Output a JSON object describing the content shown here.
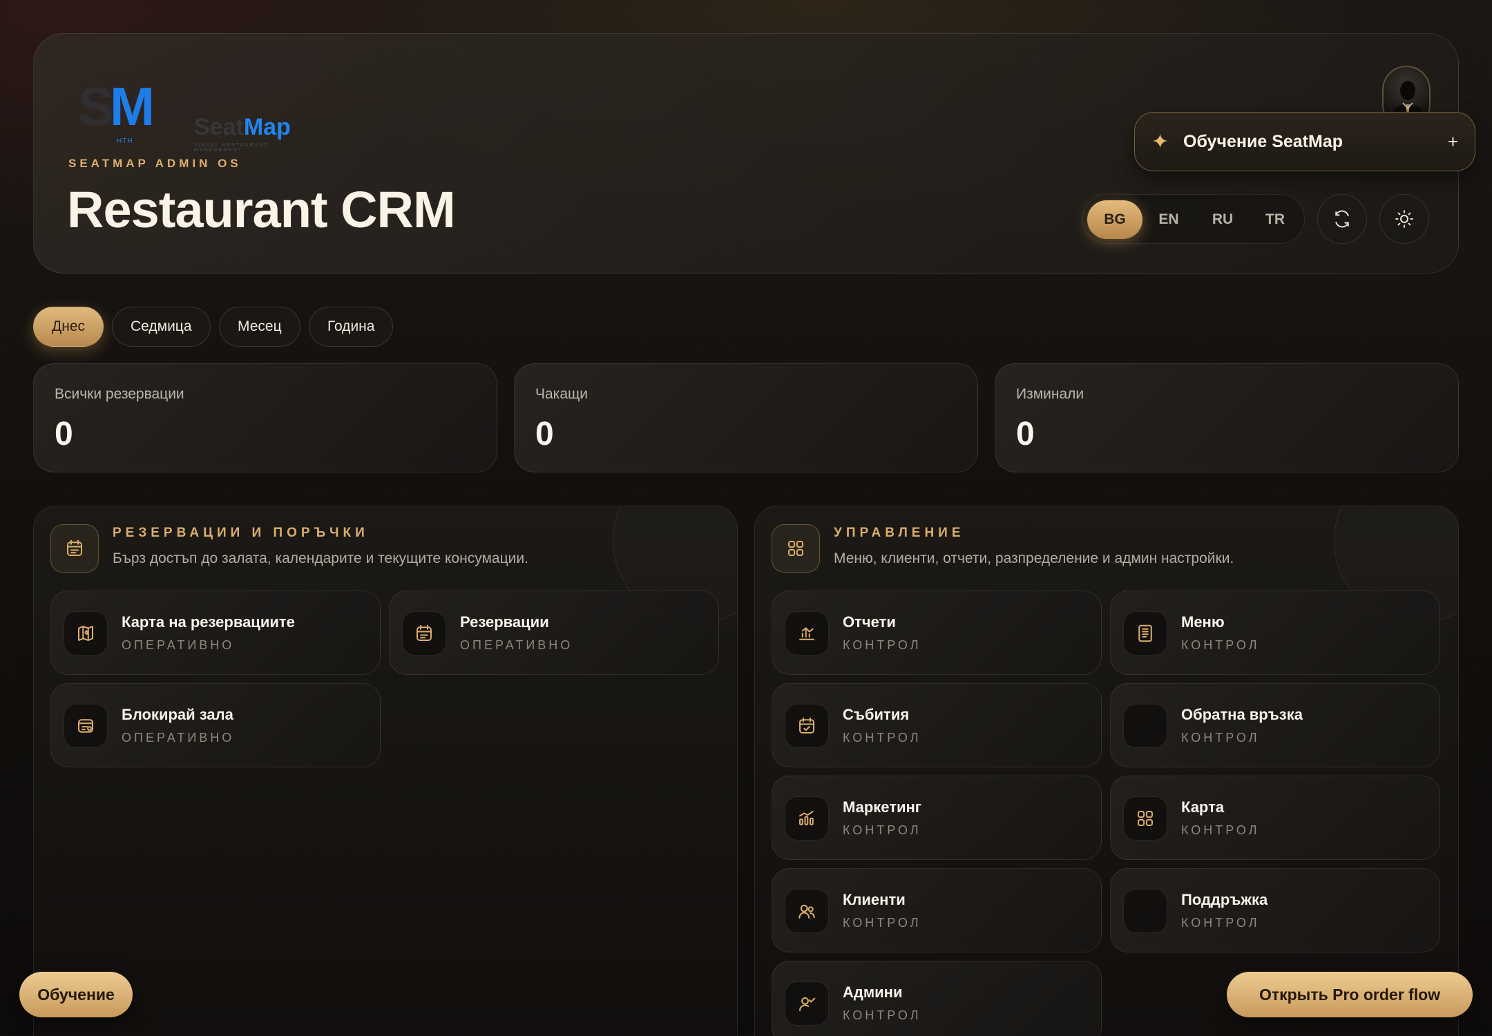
{
  "brand": {
    "logo_initials_s": "S",
    "logo_initials_m": "M",
    "logo_hth": "HTH",
    "name_seat": "Seat",
    "name_map": "Map",
    "tagline": "Visual restaurant management"
  },
  "header": {
    "kicker": "SEATMAP ADMIN OS",
    "title": "Restaurant CRM",
    "onboarding_label": "Обучение SeatMap",
    "onboarding_plus": "+",
    "languages": [
      "BG",
      "EN",
      "RU",
      "TR"
    ],
    "active_language": "BG"
  },
  "periods": [
    "Днес",
    "Седмица",
    "Месец",
    "Година"
  ],
  "active_period": "Днес",
  "stats": [
    {
      "label": "Всички резервации",
      "value": "0"
    },
    {
      "label": "Чакащи",
      "value": "0"
    },
    {
      "label": "Изминали",
      "value": "0"
    }
  ],
  "reservations_panel": {
    "title": "РЕЗЕРВАЦИИ И ПОРЪЧКИ",
    "subtitle": "Бърз достъп до залата, календарите и текущите консумации.",
    "tiles": [
      {
        "title": "Карта на резервациите",
        "sub": "ОПЕРАТИВНО",
        "icon": "map-icon"
      },
      {
        "title": "Резервации",
        "sub": "ОПЕРАТИВНО",
        "icon": "calendar-icon"
      },
      {
        "title": "Блокирай зала",
        "sub": "ОПЕРАТИВНО",
        "icon": "block-card-icon"
      }
    ]
  },
  "management_panel": {
    "title": "УПРАВЛЕНИЕ",
    "subtitle": "Меню, клиенти, отчети, разпределение и админ настройки.",
    "tiles": [
      {
        "title": "Отчети",
        "sub": "КОНТРОЛ",
        "icon": "chart-icon"
      },
      {
        "title": "Меню",
        "sub": "КОНТРОЛ",
        "icon": "menu-book-icon"
      },
      {
        "title": "Събития",
        "sub": "КОНТРОЛ",
        "icon": "event-calendar-icon"
      },
      {
        "title": "Обратна връзка",
        "sub": "КОНТРОЛ",
        "icon": "blank-icon"
      },
      {
        "title": "Маркетинг",
        "sub": "КОНТРОЛ",
        "icon": "marketing-icon"
      },
      {
        "title": "Карта",
        "sub": "КОНТРОЛ",
        "icon": "grid-icon"
      },
      {
        "title": "Клиенти",
        "sub": "КОНТРОЛ",
        "icon": "users-icon"
      },
      {
        "title": "Поддръжка",
        "sub": "КОНТРОЛ",
        "icon": "blank-icon"
      },
      {
        "title": "Админи",
        "sub": "КОНТРОЛ",
        "icon": "admin-icon"
      }
    ]
  },
  "floating": {
    "tutorial_label": "Обучение",
    "pro_label": "Открыть Pro order flow"
  },
  "colors": {
    "accent_gold": "#dcae6c",
    "brand_blue": "#1e7de8",
    "background": "#120f0d"
  }
}
